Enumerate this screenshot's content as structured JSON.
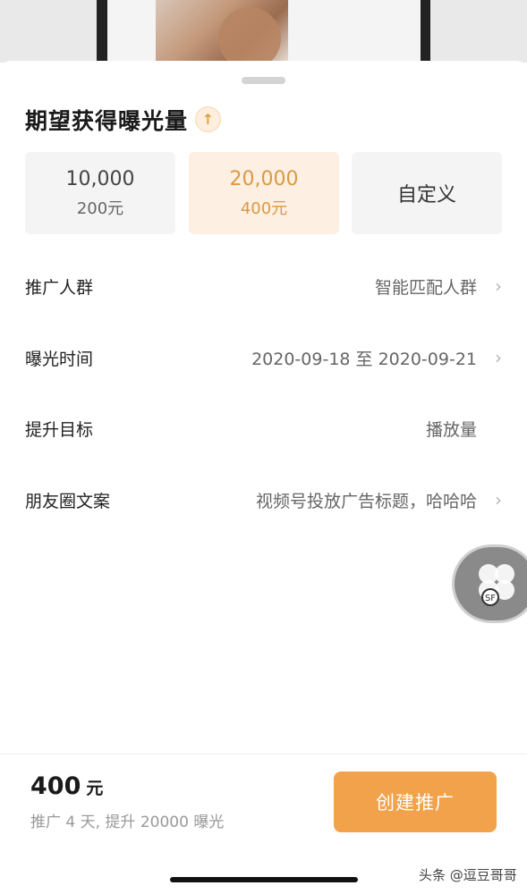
{
  "header": {
    "title": "期望获得曝光量"
  },
  "options": [
    {
      "main": "10,000",
      "sub": "200元",
      "selected": false
    },
    {
      "main": "20,000",
      "sub": "400元",
      "selected": true
    },
    {
      "single": "自定义",
      "selected": false
    }
  ],
  "rows": [
    {
      "label": "推广人群",
      "value": "智能匹配人群",
      "has_arrow": true
    },
    {
      "label": "曝光时间",
      "value": "2020-09-18 至 2020-09-21",
      "has_arrow": true
    },
    {
      "label": "提升目标",
      "value": "播放量",
      "has_arrow": false
    },
    {
      "label": "朋友圈文案",
      "value": "视频号投放广告标题，哈哈哈",
      "has_arrow": true
    }
  ],
  "footer": {
    "price": "400",
    "price_unit": "元",
    "description": "推广 4 天, 提升 20000 曝光",
    "create_label": "创建推广"
  },
  "watermark": "头条 @逗豆哥哥",
  "colors": {
    "accent": "#f2a24b",
    "accent_text": "#d99a45",
    "selected_bg": "#fdefe1"
  },
  "icons": {
    "title_badge": "up-arrow-icon",
    "row_arrow": "chevron-right-icon"
  }
}
